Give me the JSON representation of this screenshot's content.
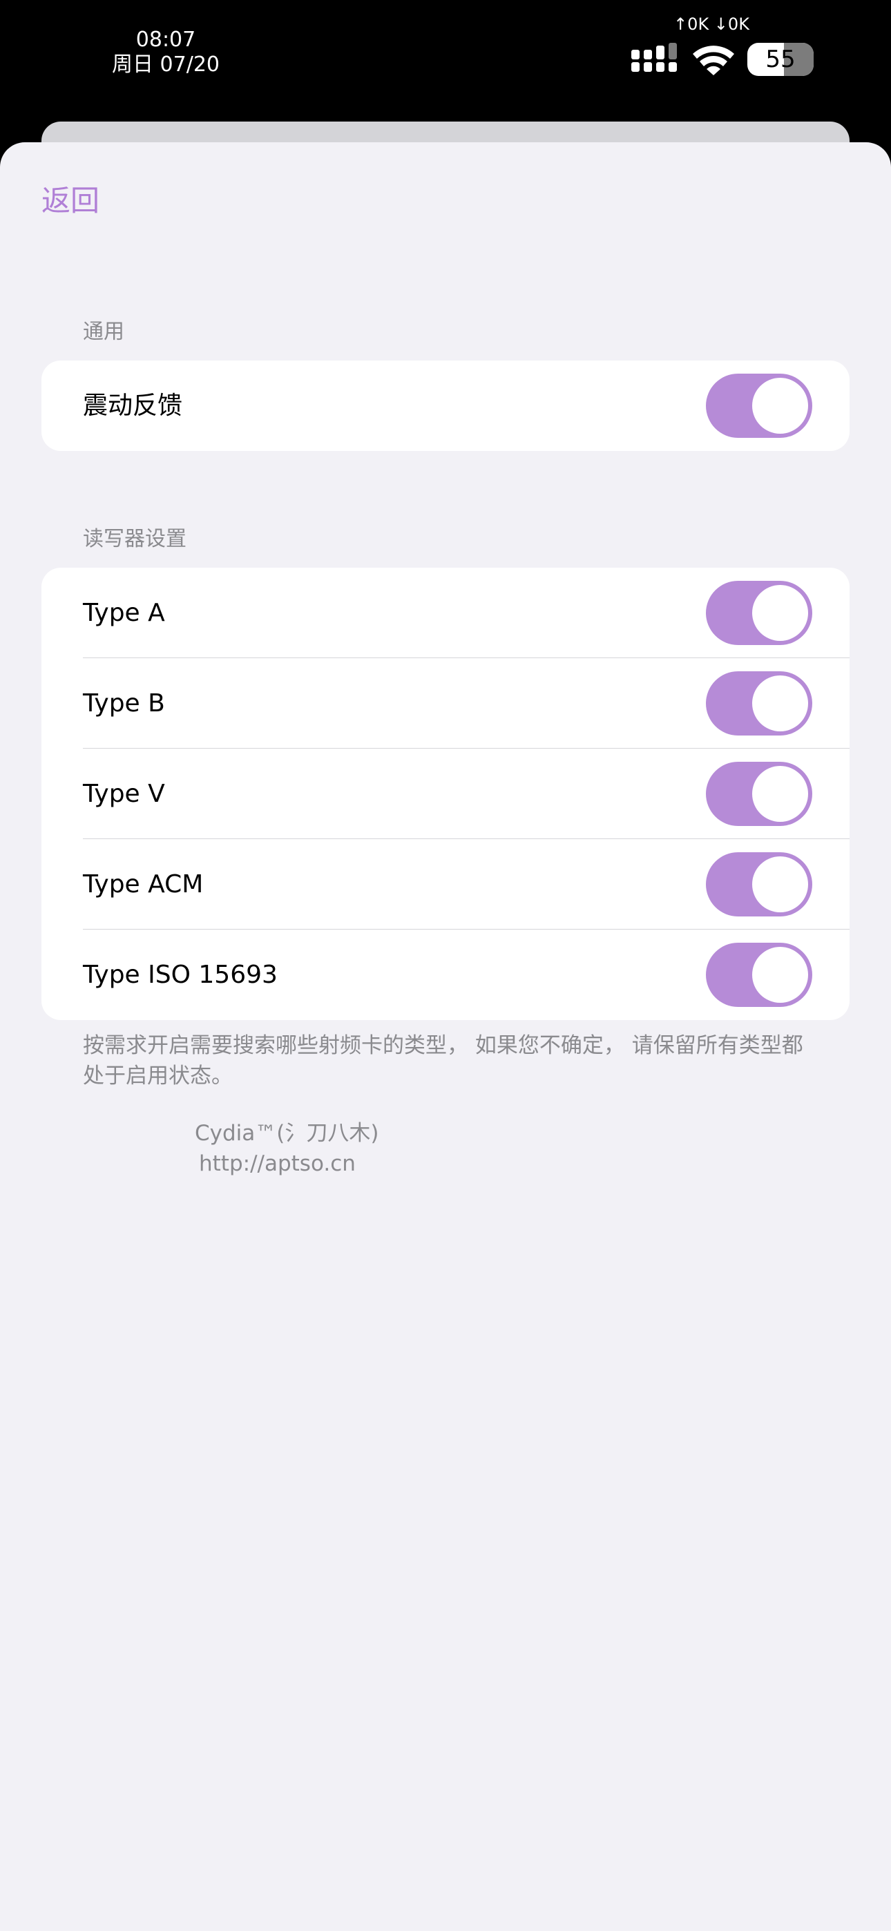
{
  "status_bar": {
    "time": "08:07",
    "date": "周日 07/20",
    "net_speed": "↑0K ↓0K",
    "battery_level": "55",
    "battery_fraction": 0.55
  },
  "nav": {
    "back_label": "返回"
  },
  "sections": {
    "general": {
      "header": "通用",
      "items": [
        {
          "label": "震动反馈",
          "enabled": true
        }
      ]
    },
    "reader": {
      "header": "读写器设置",
      "items": [
        {
          "label": "Type A",
          "enabled": true
        },
        {
          "label": "Type B",
          "enabled": true
        },
        {
          "label": "Type V",
          "enabled": true
        },
        {
          "label": "Type ACM",
          "enabled": true
        },
        {
          "label": "Type ISO 15693",
          "enabled": true
        }
      ],
      "footer": "按需求开启需要搜索哪些射频卡的类型， 如果您不确定， 请保留所有类型都处于启用状态。"
    }
  },
  "credits": {
    "line1": "Cydia™(氵刀八木)",
    "line2": "http://aptso.cn"
  },
  "colors": {
    "accent": "#b07fd6",
    "toggle_on": "#b68bd7",
    "background": "#f2f1f6"
  }
}
